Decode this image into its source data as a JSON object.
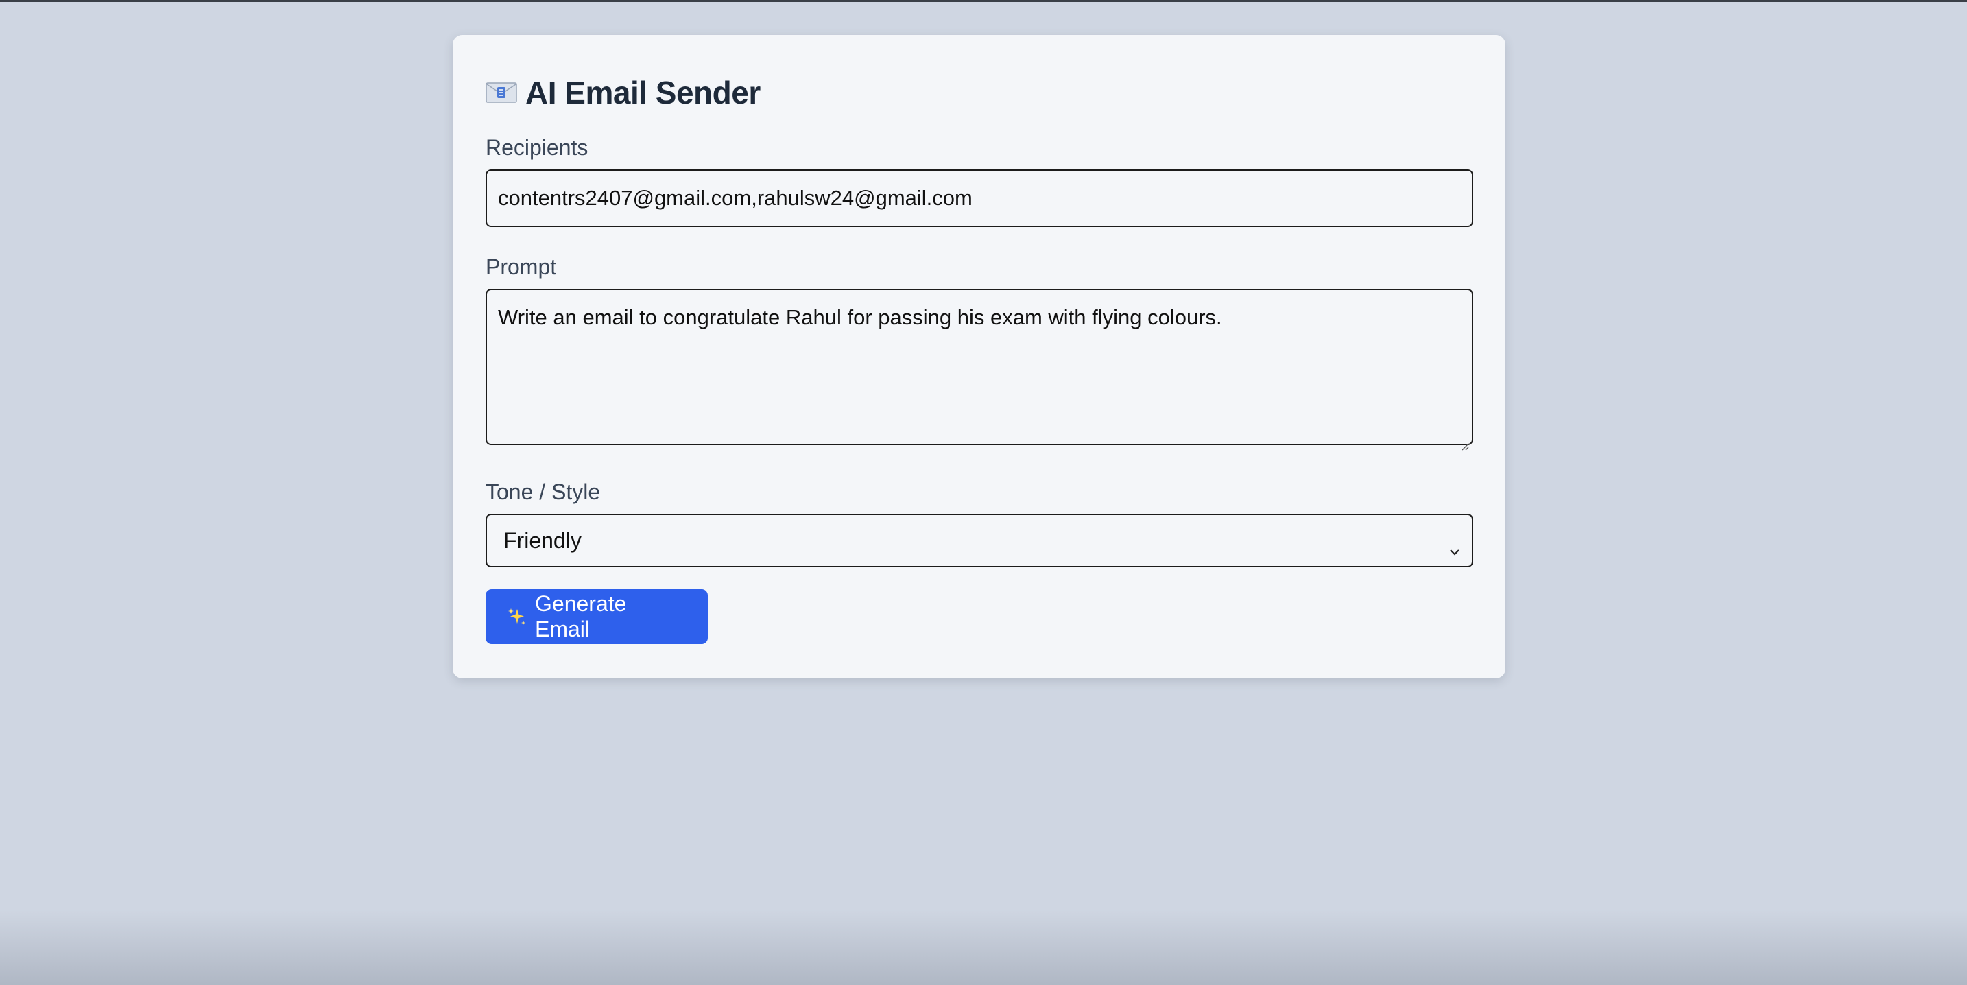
{
  "app": {
    "title": "AI Email Sender",
    "title_icon": "envelope-icon"
  },
  "form": {
    "recipients": {
      "label": "Recipients",
      "value": "contentrs2407@gmail.com,rahulsw24@gmail.com"
    },
    "prompt": {
      "label": "Prompt",
      "value": "Write an email to congratulate Rahul for passing his exam with flying colours."
    },
    "tone": {
      "label": "Tone / Style",
      "selected": "Friendly"
    },
    "submit": {
      "label": "Generate Email",
      "icon": "sparkles-icon"
    }
  },
  "colors": {
    "page_background": "#cfd6e2",
    "card_background": "#f4f6f9",
    "primary_button": "#2e60ec",
    "title_text": "#1e2a3a",
    "label_text": "#3a4658"
  }
}
